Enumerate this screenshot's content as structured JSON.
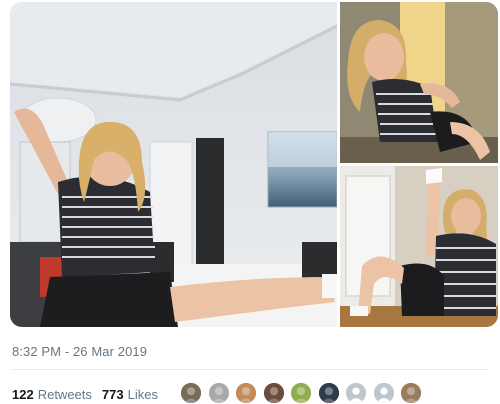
{
  "tweet": {
    "timestamp": "8:32 PM - 26 Mar 2019",
    "retweets": {
      "count": "122",
      "label": "Retweets"
    },
    "likes": {
      "count": "773",
      "label": "Likes"
    }
  },
  "photos": [
    {
      "name": "photo-main",
      "icon": "photo"
    },
    {
      "name": "photo-top-right",
      "icon": "photo"
    },
    {
      "name": "photo-bottom-right",
      "icon": "photo"
    }
  ],
  "liker_avatars": [
    {
      "color": "#7a6a58"
    },
    {
      "color": "#a9a9a9"
    },
    {
      "color": "#c28b5a"
    },
    {
      "color": "#6b4b3a"
    },
    {
      "color": "#8fae4f"
    },
    {
      "color": "#2f3b4a"
    },
    {
      "color": "#bfc7ce",
      "default": true
    },
    {
      "color": "#bfc7ce",
      "default": true
    },
    {
      "color": "#9a7b5e"
    }
  ]
}
